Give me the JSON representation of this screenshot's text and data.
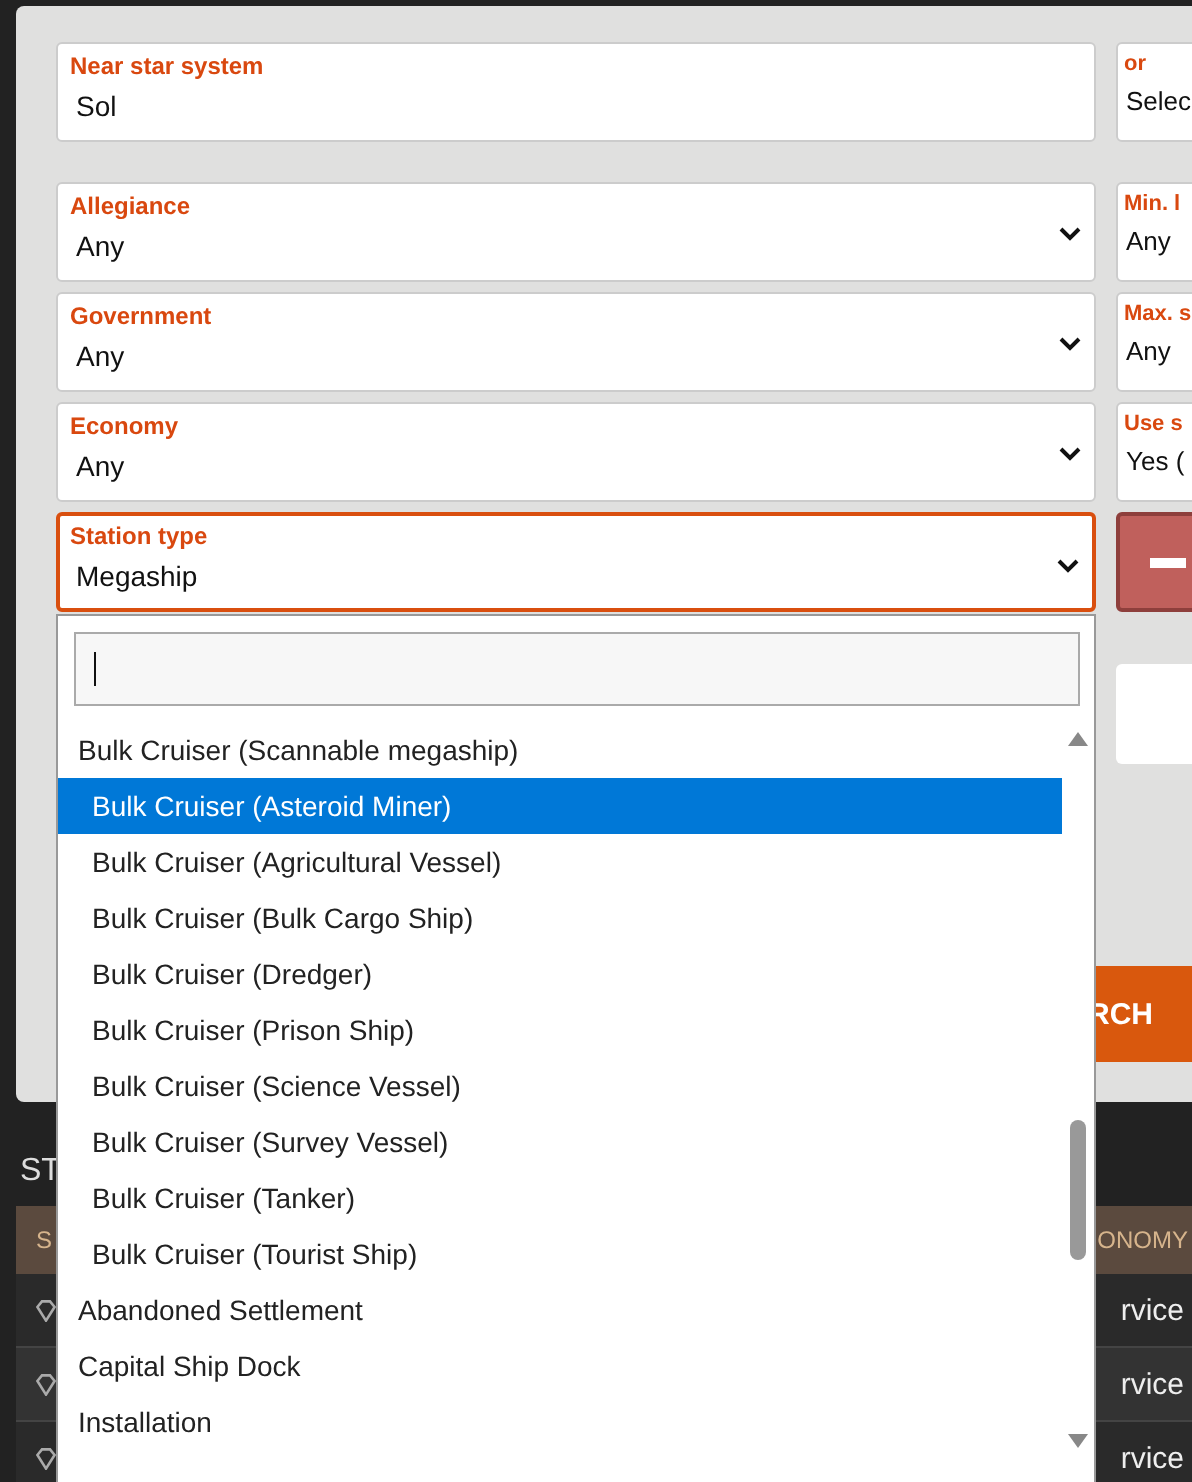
{
  "search_form": {
    "left_fields": [
      {
        "label": "Near star system",
        "value": "Sol",
        "kind": "text",
        "focused": false
      },
      {
        "label": "Allegiance",
        "value": "Any",
        "kind": "select",
        "focused": false
      },
      {
        "label": "Government",
        "value": "Any",
        "kind": "select",
        "focused": false
      },
      {
        "label": "Economy",
        "value": "Any",
        "kind": "select",
        "focused": false
      },
      {
        "label": "Station type",
        "value": "Megaship",
        "kind": "select",
        "focused": true
      }
    ],
    "right_fields": [
      {
        "label": "or",
        "value": "Selec"
      },
      {
        "label": "Min. l",
        "value": "Any"
      },
      {
        "label": "Max. s",
        "value": "Any"
      },
      {
        "label": "Use s",
        "value": "Yes ("
      }
    ],
    "search_button": "RCH"
  },
  "dropdown": {
    "options": [
      {
        "label": "Bulk Cruiser (Scannable megaship)",
        "selected": false,
        "children": [
          {
            "label": "Bulk Cruiser (Asteroid Miner)",
            "selected": true
          },
          {
            "label": "Bulk Cruiser (Agricultural Vessel)",
            "selected": false
          },
          {
            "label": "Bulk Cruiser (Bulk Cargo Ship)",
            "selected": false
          },
          {
            "label": "Bulk Cruiser (Dredger)",
            "selected": false
          },
          {
            "label": "Bulk Cruiser (Prison Ship)",
            "selected": false
          },
          {
            "label": "Bulk Cruiser (Science Vessel)",
            "selected": false
          },
          {
            "label": "Bulk Cruiser (Survey Vessel)",
            "selected": false
          },
          {
            "label": "Bulk Cruiser (Tanker)",
            "selected": false
          },
          {
            "label": "Bulk Cruiser (Tourist Ship)",
            "selected": false
          }
        ]
      },
      {
        "label": "Abandoned Settlement",
        "selected": false
      },
      {
        "label": "Capital Ship Dock",
        "selected": false
      },
      {
        "label": "Installation",
        "selected": false
      }
    ]
  },
  "results": {
    "heading": "ST",
    "columns": [
      "S",
      "ONOMY"
    ],
    "rows": [
      {
        "column_2": "rvice"
      },
      {
        "column_2": "rvice"
      },
      {
        "column_2": "rvice"
      }
    ]
  }
}
